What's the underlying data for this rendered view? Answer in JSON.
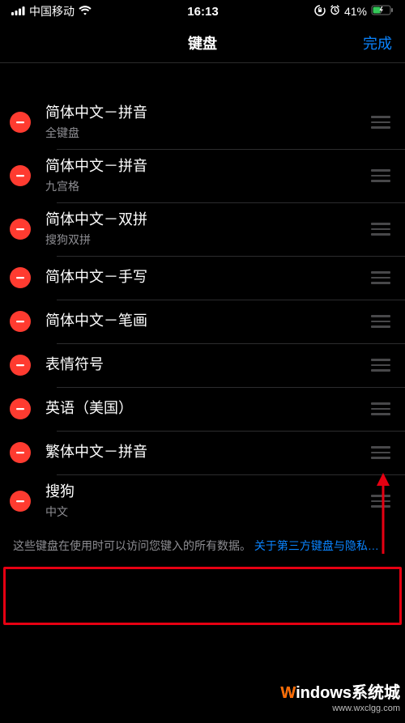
{
  "status": {
    "carrier": "中国移动",
    "time": "16:13",
    "battery": "41%"
  },
  "nav": {
    "title": "键盘",
    "done": "完成"
  },
  "rows": [
    {
      "title": "简体中文－拼音",
      "sub": "全键盘"
    },
    {
      "title": "简体中文－拼音",
      "sub": "九宫格"
    },
    {
      "title": "简体中文－双拼",
      "sub": "搜狗双拼"
    },
    {
      "title": "简体中文－手写",
      "sub": ""
    },
    {
      "title": "简体中文－笔画",
      "sub": ""
    },
    {
      "title": "表情符号",
      "sub": ""
    },
    {
      "title": "英语（美国）",
      "sub": ""
    },
    {
      "title": "繁体中文－拼音",
      "sub": ""
    },
    {
      "title": "搜狗",
      "sub": "中文"
    }
  ],
  "footer": {
    "text": "这些键盘在使用时可以访问您键入的所有数据。",
    "link": "关于第三方键盘与隐私…"
  },
  "watermark": {
    "line1_prefix": "W",
    "line1_rest": "indows系统城",
    "line2": "www.wxclgg.com"
  },
  "highlight_index": 8
}
